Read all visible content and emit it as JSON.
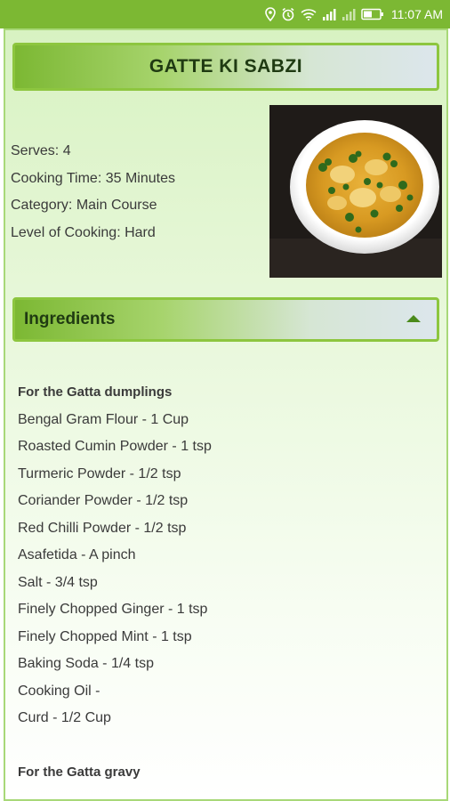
{
  "status_bar": {
    "time": "11:07 AM",
    "icons": [
      "location-icon",
      "alarm-icon",
      "wifi-icon",
      "signal-icon",
      "signal-icon-2",
      "battery-icon"
    ],
    "color": "#7cb833"
  },
  "recipe": {
    "title": "GATTE KI SABZI",
    "info": {
      "serves": "Serves: 4",
      "cooking_time": "Cooking Time: 35 Minutes",
      "category": "Category: Main Course",
      "level": "Level of Cooking: Hard"
    }
  },
  "ingredients": {
    "header": "Ingredients",
    "toggle_icon": "chevron-up-icon",
    "sections": [
      {
        "title": "For the Gatta dumplings",
        "items": [
          "Bengal Gram Flour - 1 Cup",
          "Roasted Cumin Powder - 1 tsp",
          "Turmeric Powder - 1/2 tsp",
          "Coriander Powder - 1/2 tsp",
          "Red Chilli Powder - 1/2 tsp",
          "Asafetida - A pinch",
          "Salt - 3/4 tsp",
          "Finely Chopped Ginger - 1 tsp",
          "Finely Chopped Mint - 1 tsp",
          "Baking Soda - 1/4 tsp",
          "Cooking Oil -",
          "Curd - 1/2 Cup"
        ]
      },
      {
        "title": "For the Gatta gravy",
        "items": []
      }
    ]
  },
  "colors": {
    "accent": "#8dc63f",
    "dark_green": "#1f3a12",
    "text": "#3a3a3a"
  }
}
